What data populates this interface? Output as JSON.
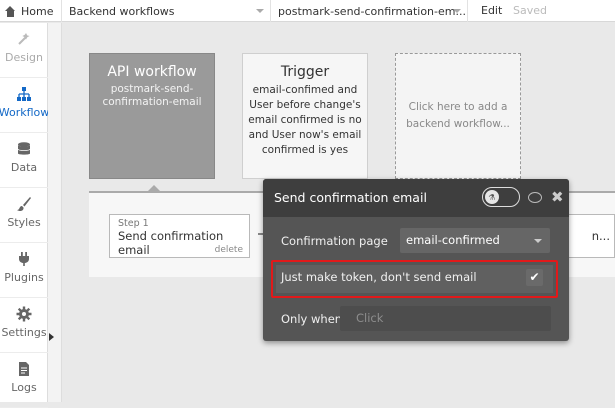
{
  "topbar": {
    "home_label": "Home",
    "page_select": "Backend workflows",
    "workflow_select": "postmark-send-confirmation-em...",
    "edit_label": "Edit",
    "saved_label": "Saved"
  },
  "sidebar": {
    "items": [
      {
        "label": "Design",
        "icon": "design-icon"
      },
      {
        "label": "Workflow",
        "icon": "workflow-icon"
      },
      {
        "label": "Data",
        "icon": "data-icon"
      },
      {
        "label": "Styles",
        "icon": "styles-icon"
      },
      {
        "label": "Plugins",
        "icon": "plugins-icon"
      },
      {
        "label": "Settings",
        "icon": "settings-icon"
      },
      {
        "label": "Logs",
        "icon": "logs-icon"
      }
    ],
    "active": "Workflow"
  },
  "canvas": {
    "api_card": {
      "title": "API workflow",
      "subtitle": "postmark-send-confirmation-email"
    },
    "trigger_card": {
      "title": "Trigger",
      "subtitle": "email-confimed and User before change's email confirmed is no and User now's email confirmed is yes"
    },
    "add_card": {
      "label": "Click here to add a backend workflow..."
    },
    "step": {
      "number": "Step 1",
      "title": "Send confirmation email",
      "delete_label": "delete"
    },
    "step2_fragment": "n..."
  },
  "popup": {
    "title": "Send confirmation email",
    "confirmation_page_label": "Confirmation page",
    "confirmation_page_value": "email-confirmed",
    "token_only_label": "Just make token, don't send email",
    "token_only_checked": true,
    "only_when_label": "Only when",
    "only_when_placeholder": "Click",
    "highlight_color": "#e2191a"
  }
}
